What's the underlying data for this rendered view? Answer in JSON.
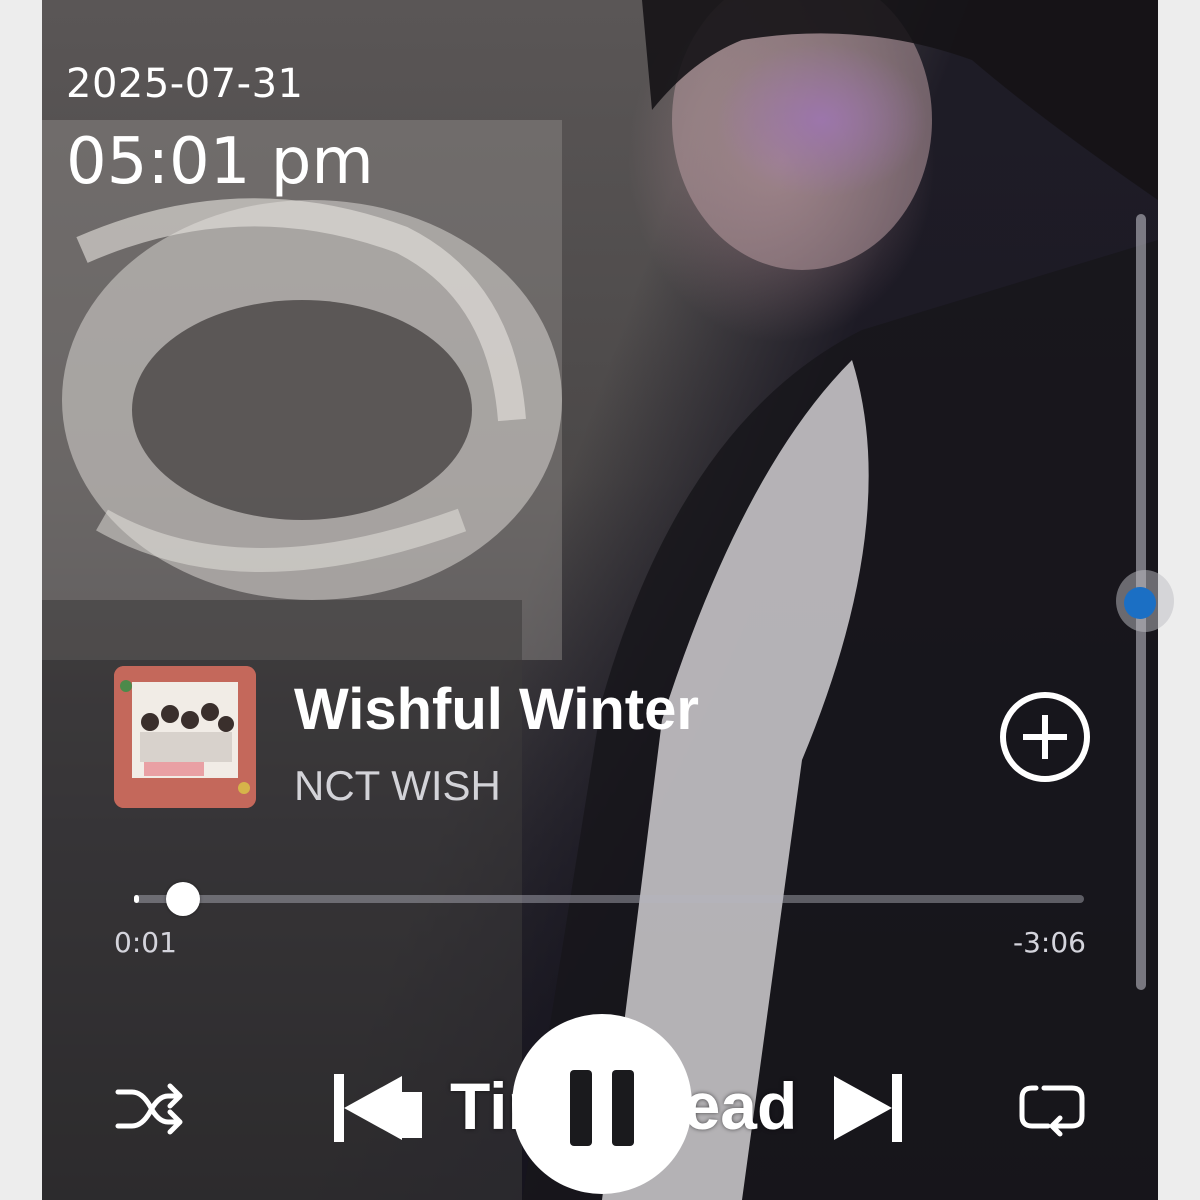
{
  "status": {
    "date": "2025-07-31",
    "time": "05:01 pm"
  },
  "now_playing": {
    "title": "Wishful Winter",
    "artist": "NCT WISH",
    "add_icon": "plus-circle-icon",
    "album_art_icon": "album-cover"
  },
  "progress": {
    "elapsed": "0:01",
    "remaining": "-3:06",
    "fraction": 0.005
  },
  "controls": {
    "shuffle_icon": "shuffle-icon",
    "previous_icon": "skip-previous-icon",
    "pause_icon": "pause-icon",
    "next_icon": "skip-next-icon",
    "repeat_icon": "repeat-icon",
    "overlay_text": "Times read"
  },
  "volume": {
    "level": 0.5,
    "accent_color": "#1b6fc4"
  }
}
